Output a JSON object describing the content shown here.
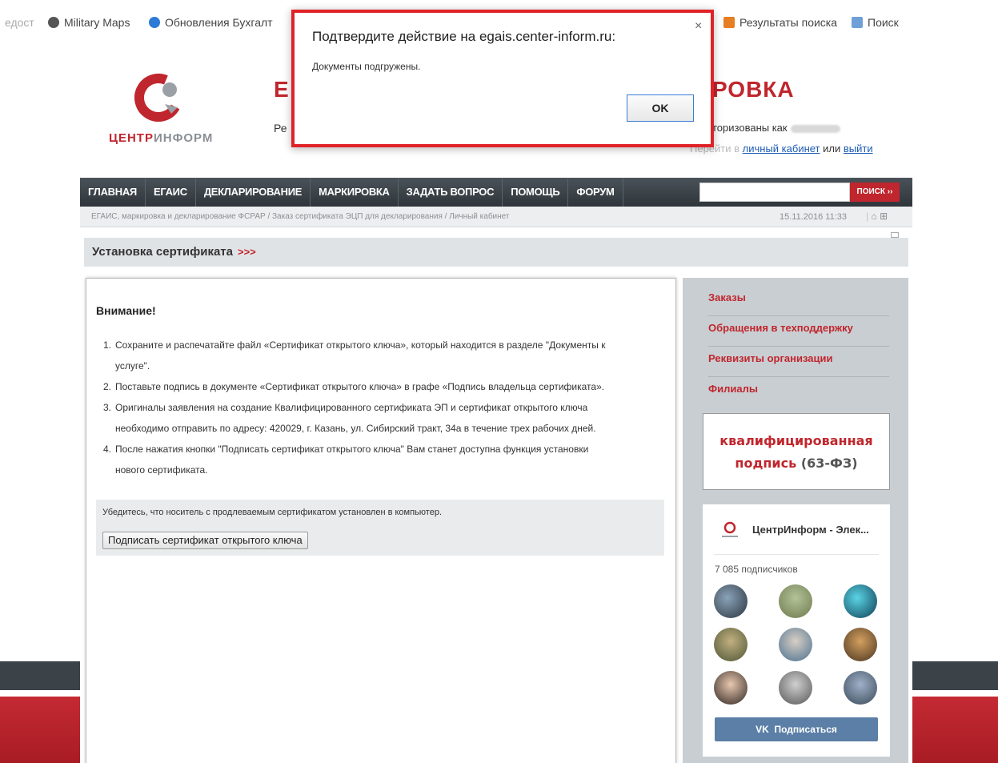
{
  "bookmarks": [
    {
      "label": "едост",
      "faded": true
    },
    {
      "label": "Military Maps",
      "icon": "military-icon"
    },
    {
      "label": "Обновления Бухгалт",
      "icon": "info-icon"
    },
    {
      "label": "Результаты поиска",
      "icon": "search-results-icon"
    },
    {
      "label": "Поиск",
      "icon": "search-page-icon"
    }
  ],
  "header": {
    "logo_part1": "ЦЕНТР",
    "logo_part2": "ИНФОРМ",
    "title_left": "Е",
    "title_right": "РОВКА",
    "subtitle": "Ре",
    "auth_text": "торизованы как",
    "cab_prefix": "Перейти в",
    "cab_link": "личный кабинет",
    "cab_mid": "или",
    "logout_link": "выйти"
  },
  "nav": {
    "items": [
      "ГЛАВНАЯ",
      "ЕГАИС",
      "ДЕКЛАРИРОВАНИЕ",
      "МАРКИРОВКА",
      "ЗАДАТЬ ВОПРОС",
      "ПОМОЩЬ",
      "ФОРУМ"
    ],
    "search_value": "",
    "search_button": "ПОИСК ››"
  },
  "breadcrumb": {
    "path": "ЕГАИС, маркировка и декларирование ФСРАР / Заказ сертификата ЭЦП для декларирования / Личный кабинет",
    "datetime": "15.11.2016 11:33"
  },
  "section": {
    "title": "Установка сертификата",
    "arrows": ">>>"
  },
  "main": {
    "heading": "Внимание!",
    "steps": [
      {
        "n": "1.",
        "lines": [
          "Сохраните и распечатайте файл «Сертификат открытого ключа», который находится в разделе \"Документы к",
          "услуге\"."
        ]
      },
      {
        "n": "2.",
        "lines": [
          "Поставьте подпись в документе «Сертификат открытого ключа» в графе «Подпись владельца сертификата»."
        ]
      },
      {
        "n": "3.",
        "lines": [
          "Оригиналы заявления на создание Квалифицированного сертификата ЭП и сертификат открытого ключа",
          "необходимо отправить по адресу: 420029, г. Казань, ул. Сибирский тракт, 34а в течение трех рабочих дней."
        ]
      },
      {
        "n": "4.",
        "lines": [
          "После нажатия кнопки \"Подписать сертификат открытого ключа\" Вам станет доступна функция установки",
          "нового сертификата."
        ]
      }
    ],
    "sign_note": "Убедитесь, что носитель с продлеваемым сертификатом установлен в компьютер.",
    "sign_button": "Подписать сертификат открытого ключа"
  },
  "sidebar": {
    "links": [
      "Заказы",
      "Обращения в техподдержку",
      "Реквизиты организации",
      "Филиалы"
    ],
    "promo_line1": "квалифицированная",
    "promo_line2_red": "подпись",
    "promo_line2_gray": "(63-ФЗ)",
    "vk_name": "ЦентрИнформ - Элек...",
    "vk_subscribers": "7 085 подписчиков",
    "vk_button": "Подписаться"
  },
  "dialog": {
    "title": "Подтвердите действие на egais.center-inform.ru:",
    "message": "Документы подгружены.",
    "ok": "OK",
    "close": "×"
  },
  "colors": {
    "brand_red": "#c0262d",
    "nav_dark": "#3b4248",
    "vk_blue": "#5b7fa6",
    "highlight_red": "#e02227"
  }
}
